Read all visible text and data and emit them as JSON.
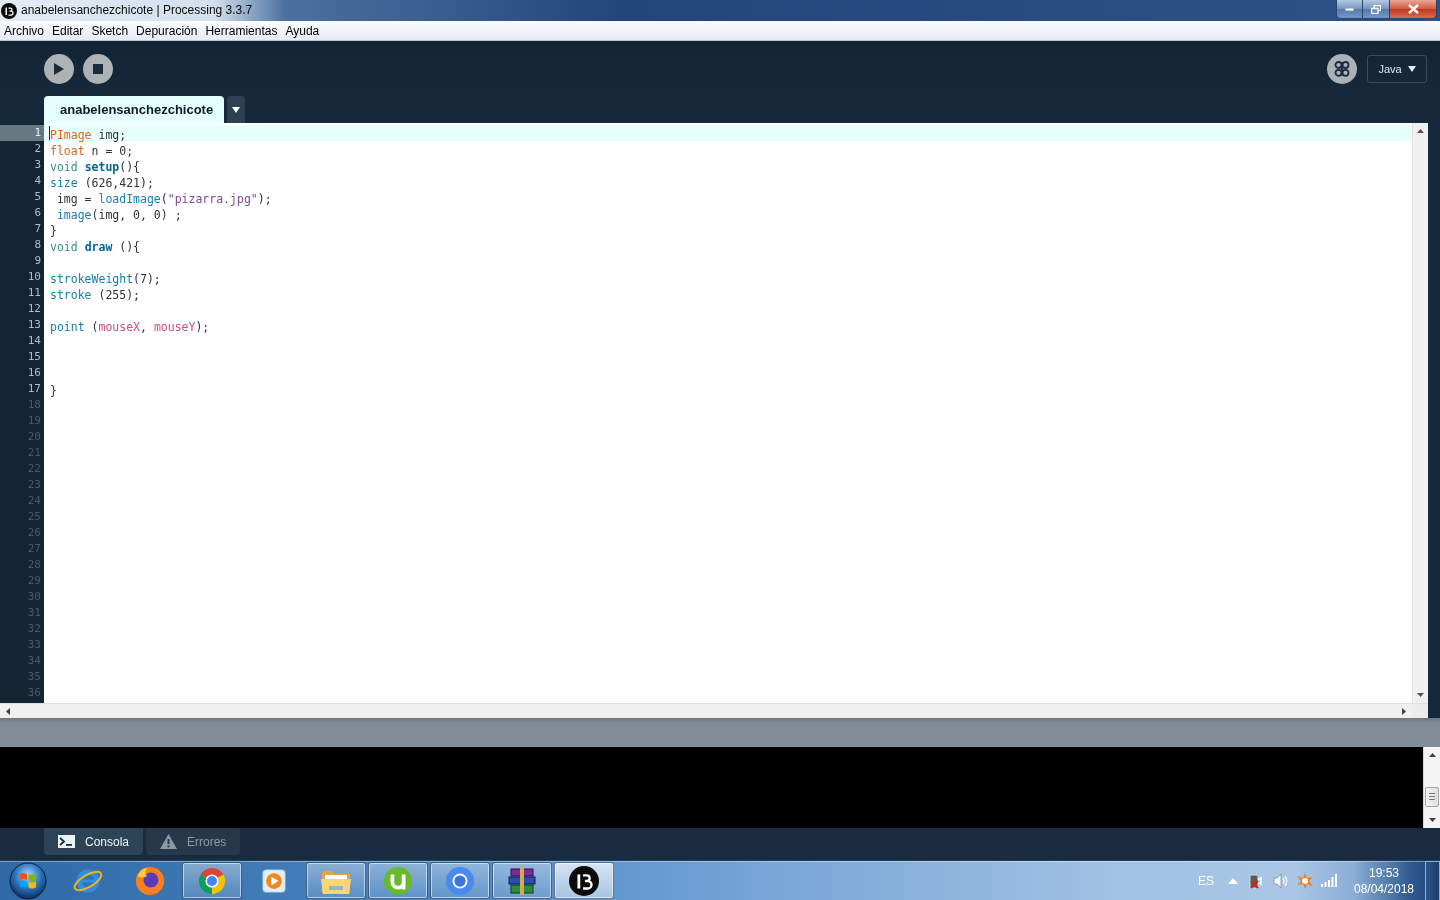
{
  "window": {
    "title": "anabelensanchezchicote | Processing 3.3.7"
  },
  "menu": [
    "Archivo",
    "Editar",
    "Sketch",
    "Depuración",
    "Herramientas",
    "Ayuda"
  ],
  "toolbar": {
    "mode": "Java"
  },
  "sketch_tabs": [
    {
      "label": "anabelensanchezchicote",
      "selected": true
    }
  ],
  "editor": {
    "lines": [
      {
        "number": "1",
        "current": true,
        "tokens": [
          {
            "kind": "type",
            "text": "PImage"
          },
          {
            "kind": "plain",
            "text": " img;"
          }
        ]
      },
      {
        "number": "2",
        "current": false,
        "tokens": [
          {
            "kind": "type",
            "text": "float"
          },
          {
            "kind": "plain",
            "text": " n = 0;"
          }
        ]
      },
      {
        "number": "3",
        "current": false,
        "tokens": [
          {
            "kind": "keyword",
            "text": "void "
          },
          {
            "kind": "function_def",
            "text": "setup"
          },
          {
            "kind": "plain",
            "text": "(){"
          }
        ]
      },
      {
        "number": "4",
        "current": false,
        "tokens": [
          {
            "kind": "function",
            "text": "size"
          },
          {
            "kind": "plain",
            "text": " (626,421);"
          }
        ]
      },
      {
        "number": "5",
        "current": false,
        "tokens": [
          {
            "kind": "plain",
            "text": " img = "
          },
          {
            "kind": "function",
            "text": "loadImage"
          },
          {
            "kind": "plain",
            "text": "("
          },
          {
            "kind": "string",
            "text": "\"pizarra.jpg\""
          },
          {
            "kind": "plain",
            "text": ");"
          }
        ]
      },
      {
        "number": "6",
        "current": false,
        "tokens": [
          {
            "kind": "function",
            "text": " image"
          },
          {
            "kind": "plain",
            "text": "(img, 0, 0) ;"
          }
        ]
      },
      {
        "number": "7",
        "current": false,
        "tokens": [
          {
            "kind": "plain",
            "text": "}"
          }
        ]
      },
      {
        "number": "8",
        "current": false,
        "tokens": [
          {
            "kind": "keyword",
            "text": "void "
          },
          {
            "kind": "function_def",
            "text": "draw"
          },
          {
            "kind": "plain",
            "text": " (){"
          }
        ]
      },
      {
        "number": "9",
        "current": false
      },
      {
        "number": "10",
        "current": false,
        "tokens": [
          {
            "kind": "function",
            "text": "strokeWeight"
          },
          {
            "kind": "plain",
            "text": "(7);"
          }
        ]
      },
      {
        "number": "11",
        "current": false,
        "tokens": [
          {
            "kind": "function",
            "text": "stroke"
          },
          {
            "kind": "plain",
            "text": " (255);"
          }
        ]
      },
      {
        "number": "12",
        "current": false
      },
      {
        "number": "13",
        "current": false,
        "tokens": [
          {
            "kind": "function",
            "text": "point"
          },
          {
            "kind": "plain",
            "text": " ("
          },
          {
            "kind": "builtin_var",
            "text": "mouseX"
          },
          {
            "kind": "plain",
            "text": ", "
          },
          {
            "kind": "builtin_var",
            "text": "mouseY"
          },
          {
            "kind": "plain",
            "text": ");"
          }
        ]
      },
      {
        "number": "14",
        "current": false
      },
      {
        "number": "15",
        "current": false
      },
      {
        "number": "16",
        "current": false
      },
      {
        "number": "17",
        "current": false,
        "tokens": [
          {
            "kind": "plain",
            "text": "}"
          }
        ]
      }
    ],
    "extra_line_numbers": [
      "18",
      "19",
      "20",
      "21",
      "22",
      "23",
      "24",
      "25",
      "26",
      "27",
      "28",
      "29",
      "30",
      "31",
      "32",
      "33",
      "34",
      "35",
      "36"
    ]
  },
  "console_tabs": [
    {
      "kind": "console",
      "label": "Consola",
      "selected": true
    },
    {
      "kind": "errors",
      "label": "Errores",
      "selected": false
    }
  ],
  "taskbar": {
    "apps": [
      {
        "kind": "ie",
        "running": false,
        "selected": false
      },
      {
        "kind": "firefox",
        "running": false,
        "selected": false
      },
      {
        "kind": "chrome",
        "running": true,
        "selected": false
      },
      {
        "kind": "media",
        "running": false,
        "selected": false
      },
      {
        "kind": "explorer",
        "running": true,
        "selected": false
      },
      {
        "kind": "torrent",
        "running": true,
        "selected": false
      },
      {
        "kind": "chromium",
        "running": true,
        "selected": false
      },
      {
        "kind": "archive",
        "running": true,
        "selected": false
      },
      {
        "kind": "processing",
        "running": true,
        "selected": true
      }
    ],
    "tray": {
      "language": "ES"
    },
    "clock": {
      "time": "19:53",
      "date": "08/04/2018"
    }
  }
}
